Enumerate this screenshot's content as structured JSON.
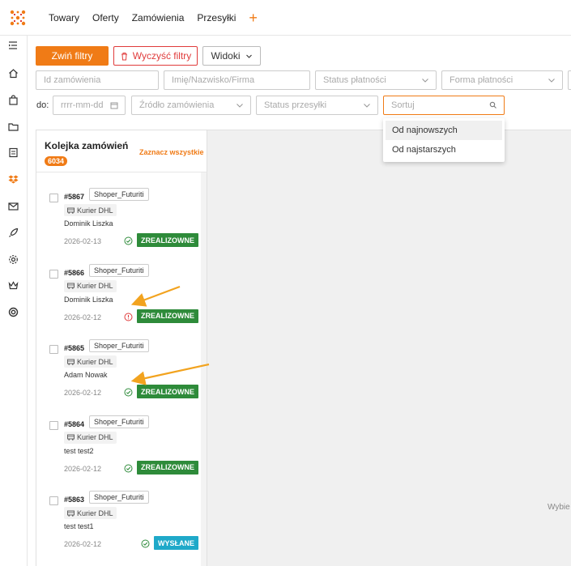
{
  "nav": {
    "items": [
      "Towary",
      "Oferty",
      "Zamówienia",
      "Przesyłki"
    ],
    "plus": "+"
  },
  "toolbar": {
    "collapse_filters": "Zwiń filtry",
    "clear_filters": "Wyczyść filtry",
    "views": "Widoki"
  },
  "filters": {
    "order_id_placeholder": "Id zamówienia",
    "name_placeholder": "Imię/Nazwisko/Firma",
    "payment_status_placeholder": "Status płatności",
    "payment_form_placeholder": "Forma płatności",
    "date_label": "do:",
    "date_placeholder": "rrrr-mm-dd",
    "order_source_placeholder": "Źródło zamówienia",
    "shipment_status_placeholder": "Status przesyłki",
    "sort_placeholder": "Sortuj"
  },
  "sort_dropdown": {
    "options": [
      "Od najnowszych",
      "Od najstarszych"
    ]
  },
  "queue": {
    "title": "Kolejka zamówień",
    "count": "6034",
    "select_all": "Zaznacz wszystkie",
    "orders": [
      {
        "number": "#5867",
        "shop": "Shoper_Futuriti",
        "courier": "Kurier DHL",
        "customer": "Dominik Liszka",
        "date": "2026-02-13",
        "status": "ZREALIZOWNE",
        "status_color": "#2e8b3a",
        "state_icon": "check-circle-icon"
      },
      {
        "number": "#5866",
        "shop": "Shoper_Futuriti",
        "courier": "Kurier DHL",
        "customer": "Dominik Liszka",
        "date": "2026-02-12",
        "status": "ZREALIZOWNE",
        "status_color": "#2e8b3a",
        "state_icon": "alert-circle-icon"
      },
      {
        "number": "#5865",
        "shop": "Shoper_Futuriti",
        "courier": "Kurier DHL",
        "customer": "Adam Nowak",
        "date": "2026-02-12",
        "status": "ZREALIZOWNE",
        "status_color": "#2e8b3a",
        "state_icon": "check-circle-icon"
      },
      {
        "number": "#5864",
        "shop": "Shoper_Futuriti",
        "courier": "Kurier DHL",
        "customer": "test test2",
        "date": "2026-02-12",
        "status": "ZREALIZOWNE",
        "status_color": "#2e8b3a",
        "state_icon": "check-circle-icon"
      },
      {
        "number": "#5863",
        "shop": "Shoper_Futuriti",
        "courier": "Kurier DHL",
        "customer": "test test1",
        "date": "2026-02-12",
        "status": "WYSŁANE",
        "status_color": "#1fa9c9",
        "state_icon": "check-circle-icon"
      }
    ]
  },
  "right_hint": "Wybie",
  "colors": {
    "accent": "#f07b16",
    "danger": "#e03b3b",
    "success": "#2e8b3a",
    "info": "#1fa9c9",
    "annotation_arrow": "#f2a31f"
  }
}
